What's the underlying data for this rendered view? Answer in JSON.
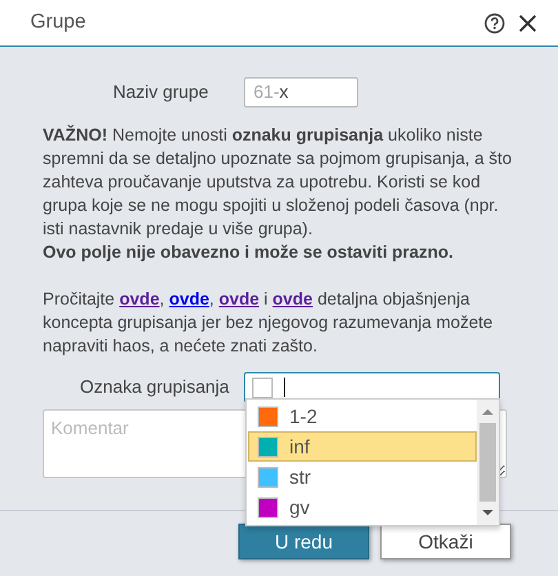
{
  "window": {
    "title": "Grupe"
  },
  "name_field": {
    "label": "Naziv grupe",
    "prefix": "61-",
    "value": "x"
  },
  "warning": {
    "text": "**VAŽNO!** Nemojte unosti **oznaku grupisanja** ukoliko niste spremni da se detaljno upoznate sa pojmom grupisanja, a što zahteva proučavanje uputstva za upotrebu. Koristi se kod grupa koje se ne mogu spojiti u složenoj podeli časova (npr. isti nastavnik predaje u više grupa).",
    "note": "Ovo polje nije obavezno i može se ostaviti prazno."
  },
  "info": [
    {
      "kind": "text",
      "text": "Pročitajte "
    },
    {
      "kind": "link",
      "text": "ovde",
      "visited": true
    },
    {
      "kind": "text",
      "text": ", "
    },
    {
      "kind": "link",
      "text": "ovde",
      "visited": false
    },
    {
      "kind": "text",
      "text": ", "
    },
    {
      "kind": "link",
      "text": "ovde",
      "visited": true
    },
    {
      "kind": "text",
      "text": " i "
    },
    {
      "kind": "link",
      "text": "ovde",
      "visited": true
    },
    {
      "kind": "text",
      "text": " detaljna objašnjenja koncepta grupisanja jer bez njegovog razumevanja možete napraviti haos, a nećete znati zašto."
    }
  ],
  "grouping_field": {
    "label": "Oznaka grupisanja",
    "options": [
      {
        "text": "1-2",
        "color": "#ff6a0d",
        "selected": false
      },
      {
        "text": "inf",
        "color": "#00b0b0",
        "selected": true
      },
      {
        "text": "str",
        "color": "#40c0ff",
        "selected": false
      },
      {
        "text": "gv",
        "color": "#c000c0",
        "selected": false
      }
    ]
  },
  "comment": {
    "placeholder": "Komentar"
  },
  "buttons": [
    {
      "kind": "primary",
      "label": "U redu"
    },
    {
      "kind": "secondary",
      "label": "Otkaži"
    }
  ]
}
